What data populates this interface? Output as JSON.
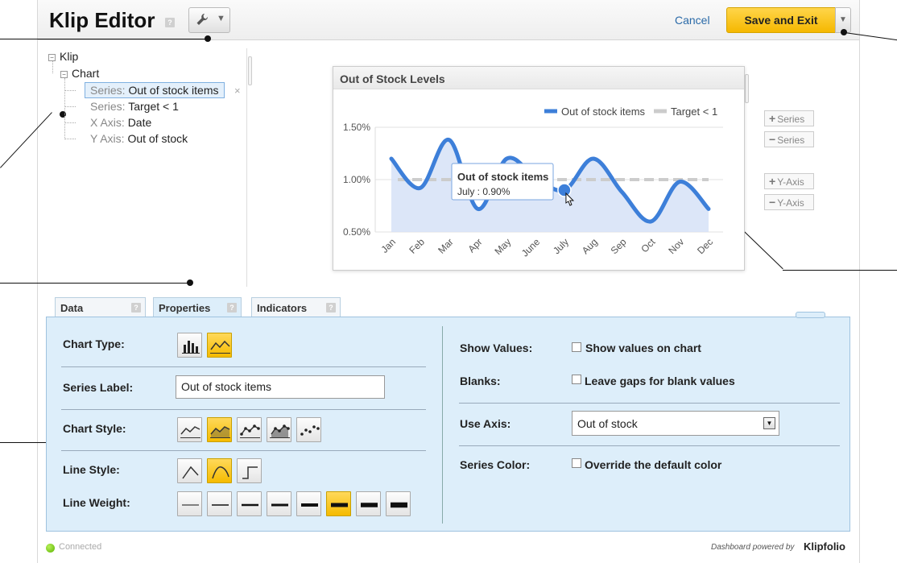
{
  "header": {
    "title": "Klip Editor",
    "help_glyph": "?",
    "tools_icon": "wrench-icon",
    "cancel_label": "Cancel",
    "save_label": "Save and Exit"
  },
  "tree": {
    "root": "Klip",
    "chart": "Chart",
    "items": [
      {
        "key": "Series:",
        "value": "Out of stock items",
        "selected": true
      },
      {
        "key": "Series:",
        "value": "Target < 1",
        "selected": false
      },
      {
        "key": "X Axis:",
        "value": "Date",
        "selected": false
      },
      {
        "key": "Y Axis:",
        "value": "Out of stock",
        "selected": false
      }
    ],
    "remove_glyph": "×"
  },
  "chart": {
    "title": "Out of Stock Levels",
    "tooltip_title": "Out of stock items",
    "tooltip_value": "July : 0.90%",
    "side_buttons": [
      {
        "sign": "+",
        "label": "Series"
      },
      {
        "sign": "−",
        "label": "Series"
      },
      {
        "sign": "+",
        "label": "Y-Axis"
      },
      {
        "sign": "−",
        "label": "Y-Axis"
      }
    ]
  },
  "chart_data": {
    "type": "area",
    "title": "Out of Stock Levels",
    "categories": [
      "Jan",
      "Feb",
      "Mar",
      "Apr",
      "May",
      "June",
      "July",
      "Aug",
      "Sep",
      "Oct",
      "Nov",
      "Dec"
    ],
    "series": [
      {
        "name": "Out of stock items",
        "values": [
          1.2,
          0.92,
          1.38,
          0.72,
          1.2,
          1.02,
          0.9,
          1.2,
          0.88,
          0.6,
          0.98,
          0.72
        ],
        "color": "#3d7fd9"
      },
      {
        "name": "Target < 1",
        "values": [
          1.0,
          1.0,
          1.0,
          1.0,
          1.0,
          1.0,
          1.0,
          1.0,
          1.0,
          1.0,
          1.0,
          1.0
        ],
        "color": "#cccccc"
      }
    ],
    "yticks": [
      "1.50%",
      "1.00%",
      "0.50%"
    ],
    "ytick_values": [
      1.5,
      1.0,
      0.5
    ],
    "ylim": [
      0.5,
      1.5
    ],
    "legend": "top-right",
    "grid": true,
    "tooltip_index": 6
  },
  "tabs": [
    {
      "label": "Data",
      "active": false
    },
    {
      "label": "Properties",
      "active": true
    },
    {
      "label": "Indicators",
      "active": false
    }
  ],
  "properties": {
    "chart_type_label": "Chart Type:",
    "series_label_label": "Series Label:",
    "series_label_value": "Out of stock items",
    "chart_style_label": "Chart Style:",
    "line_style_label": "Line Style:",
    "line_weight_label": "Line Weight:",
    "show_values_label": "Show Values:",
    "show_values_option": "Show values on chart",
    "blanks_label": "Blanks:",
    "blanks_option": "Leave gaps for blank values",
    "use_axis_label": "Use Axis:",
    "use_axis_value": "Out of stock",
    "series_color_label": "Series Color:",
    "series_color_option": "Override the default color"
  },
  "footer": {
    "status": "Connected",
    "powered": "Dashboard powered by",
    "brand": "Klipfolio"
  }
}
